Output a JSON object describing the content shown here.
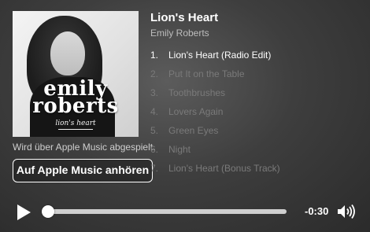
{
  "album": {
    "artist_logo": "emily roberts",
    "album_script": "lion's heart",
    "art_icon": "album-cover-portrait"
  },
  "player": {
    "title": "Lion's Heart",
    "artist": "Emily Roberts",
    "caption": "Wird über Apple Music abgespielt.",
    "listen_button": "Auf Apple Music anhören",
    "time_remaining": "-0:30",
    "progress_fraction": 0.0,
    "play_icon": "play-icon",
    "volume_icon": "speaker-volume-icon",
    "colors": {
      "active_track": "#ffffff",
      "inactive_track": "#7a7a7a",
      "background": "#3e3e3e"
    }
  },
  "tracks": [
    {
      "num": "1.",
      "label": "Lion's Heart (Radio Edit)",
      "active": true
    },
    {
      "num": "2.",
      "label": "Put It on the Table",
      "active": false
    },
    {
      "num": "3.",
      "label": "Toothbrushes",
      "active": false
    },
    {
      "num": "4.",
      "label": "Lovers Again",
      "active": false
    },
    {
      "num": "5.",
      "label": "Green Eyes",
      "active": false
    },
    {
      "num": "6.",
      "label": "Night",
      "active": false
    },
    {
      "num": "7.",
      "label": "Lion's Heart (Bonus Track)",
      "active": false
    }
  ]
}
